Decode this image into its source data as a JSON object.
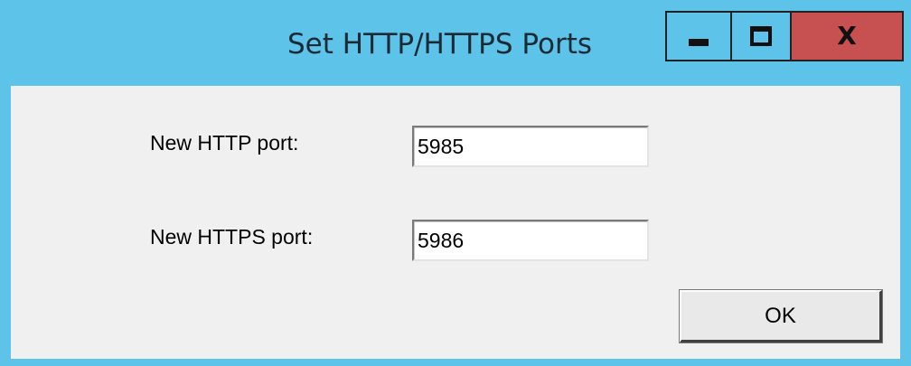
{
  "window": {
    "title": "Set HTTP/HTTPS Ports",
    "caption_buttons": {
      "minimize_icon": "minimize-icon",
      "maximize_icon": "maximize-icon",
      "close_label": "X"
    },
    "colors": {
      "frame": "#5ec3e8",
      "close_button": "#c75050",
      "client": "#f0f0f0"
    }
  },
  "form": {
    "http_label": "New HTTP port:",
    "http_value": "5985",
    "https_label": "New HTTPS port:",
    "https_value": "5986",
    "ok_label": "OK"
  }
}
